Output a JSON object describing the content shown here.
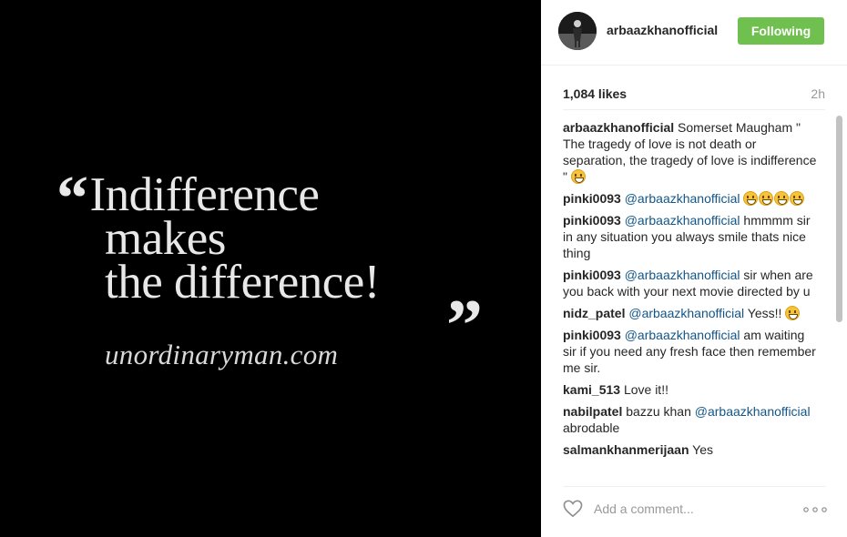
{
  "post_image": {
    "quote_line_1": "Indifference",
    "quote_line_2": "makes",
    "quote_line_3": "the difference!",
    "open_quote": "“",
    "close_quote": "”",
    "website": "unordinaryman.com"
  },
  "header": {
    "username": "arbaazkhanofficial",
    "follow_label": "Following",
    "follow_color": "#70c050"
  },
  "stats": {
    "likes": "1,084 likes",
    "time_ago": "2h"
  },
  "comments": [
    {
      "author": "arbaazkhanofficial",
      "mention": "",
      "text": " Somerset Maugham \" The tragedy of love is not death or separation, the tragedy of love is indifference \" ",
      "emoji_count": 1
    },
    {
      "author": "pinki0093",
      "mention": " @arbaazkhanofficial",
      "text": " ",
      "emoji_count": 4
    },
    {
      "author": "pinki0093",
      "mention": " @arbaazkhanofficial",
      "text": " hmmmm sir in any situation you always smile thats nice thing",
      "emoji_count": 0
    },
    {
      "author": "pinki0093",
      "mention": " @arbaazkhanofficial",
      "text": " sir when are you back with your next movie directed by u",
      "emoji_count": 0
    },
    {
      "author": "nidz_patel",
      "mention": " @arbaazkhanofficial",
      "text": " Yess!! ",
      "emoji_count": 1
    },
    {
      "author": "pinki0093",
      "mention": " @arbaazkhanofficial",
      "text": " am waiting sir if you need any fresh face then remember me sir.",
      "emoji_count": 0
    },
    {
      "author": "kami_513",
      "mention": "",
      "text": " Love it!!",
      "emoji_count": 0
    },
    {
      "author": "nabilpatel",
      "mention": "",
      "text": " bazzu khan ",
      "emoji_count": 0
    },
    {
      "author": "salmankhanmerijaan",
      "mention": "",
      "text": " Yes",
      "emoji_count": 0
    }
  ],
  "comment_8_extra": {
    "mention": "@arbaazkhanofficial",
    "text": " abrodable"
  },
  "footer": {
    "comment_placeholder": "Add a comment...",
    "like_icon": "heart-icon",
    "more_icon": "more-options-icon"
  }
}
